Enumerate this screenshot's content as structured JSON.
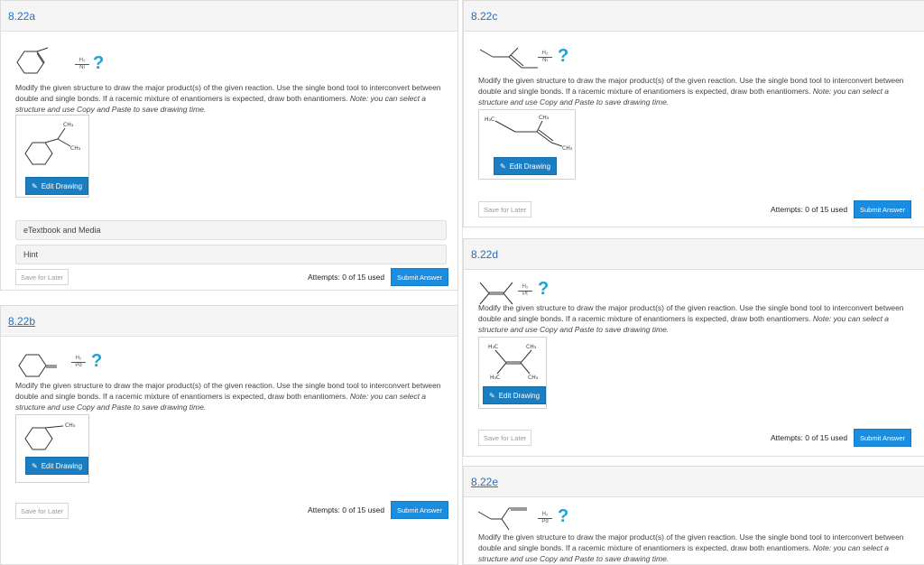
{
  "problems": {
    "p22a": {
      "title": "8.22a",
      "reagent_top": "H₂",
      "reagent_bottom": "Ni",
      "product_labels": [
        "CH₃",
        "CH₃"
      ]
    },
    "p22b": {
      "title": "8.22b",
      "reagent_top": "H₂",
      "reagent_bottom": "Pd",
      "product_labels": [
        "CH₃"
      ]
    },
    "p22c": {
      "title": "8.22c",
      "reagent_top": "H₂",
      "reagent_bottom": "Ni",
      "product_labels": [
        "H₃C",
        "CH₃",
        "CH₃"
      ]
    },
    "p22d": {
      "title": "8.22d",
      "reagent_top": "H₂",
      "reagent_bottom": "Pt",
      "product_labels": [
        "H₃C",
        "CH₃",
        "H₃C",
        "CH₃"
      ]
    },
    "p22e": {
      "title": "8.22e",
      "reagent_top": "H₂",
      "reagent_bottom": "Pd"
    }
  },
  "question_mark": "?",
  "prompt": {
    "main": "Modify the given structure to draw the major product(s) of the given reaction. Use the single bond tool to interconvert between double and single bonds. If a racemic mixture of enantiomers is expected, draw both enantiomers.",
    "note": "Note: you can select a structure and use Copy and Paste to save drawing time."
  },
  "buttons": {
    "edit_drawing": "Edit Drawing",
    "save_for_later": "Save for Later",
    "submit_answer": "Submit Answer"
  },
  "attempts": "Attempts: 0 of 15 used",
  "resources": {
    "etextbook": "eTextbook and Media",
    "hint": "Hint"
  },
  "colors": {
    "accent": "#1a8de0",
    "question": "#1aa1d6",
    "link": "#2a6db5"
  }
}
